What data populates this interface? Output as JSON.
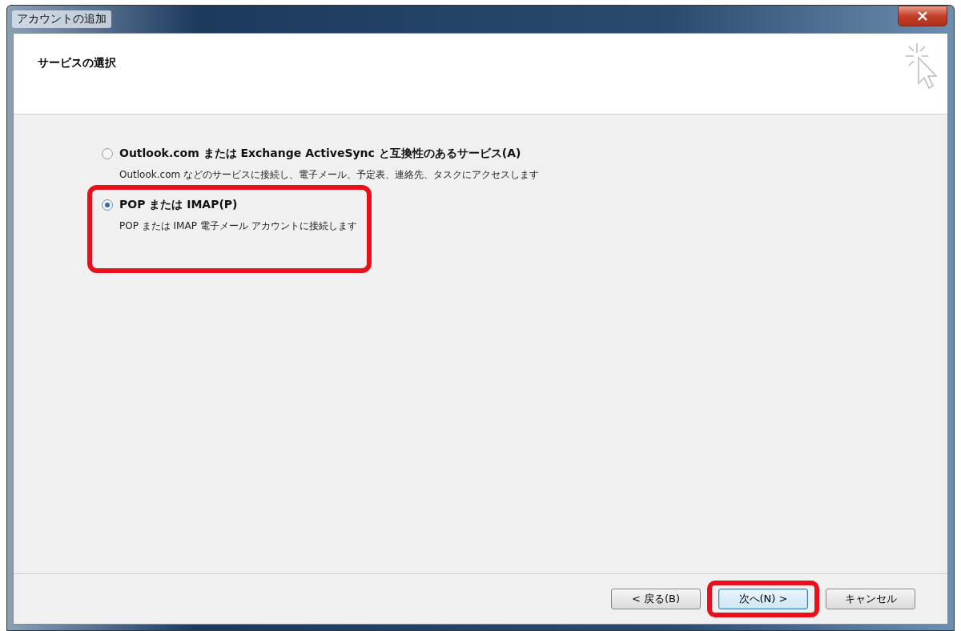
{
  "window": {
    "title": "アカウントの追加"
  },
  "header": {
    "title": "サービスの選択"
  },
  "options": [
    {
      "label": "Outlook.com または Exchange ActiveSync と互換性のあるサービス(A)",
      "description": "Outlook.com などのサービスに接続し、電子メール、予定表、連絡先、タスクにアクセスします",
      "selected": false,
      "highlighted": false
    },
    {
      "label": "POP または IMAP(P)",
      "description": "POP または IMAP 電子メール アカウントに接続します",
      "selected": true,
      "highlighted": true
    }
  ],
  "buttons": [
    {
      "label": "< 戻る(B)",
      "default": false,
      "highlighted": false
    },
    {
      "label": "次へ(N) >",
      "default": true,
      "highlighted": true
    },
    {
      "label": "キャンセル",
      "default": false,
      "highlighted": false
    }
  ]
}
